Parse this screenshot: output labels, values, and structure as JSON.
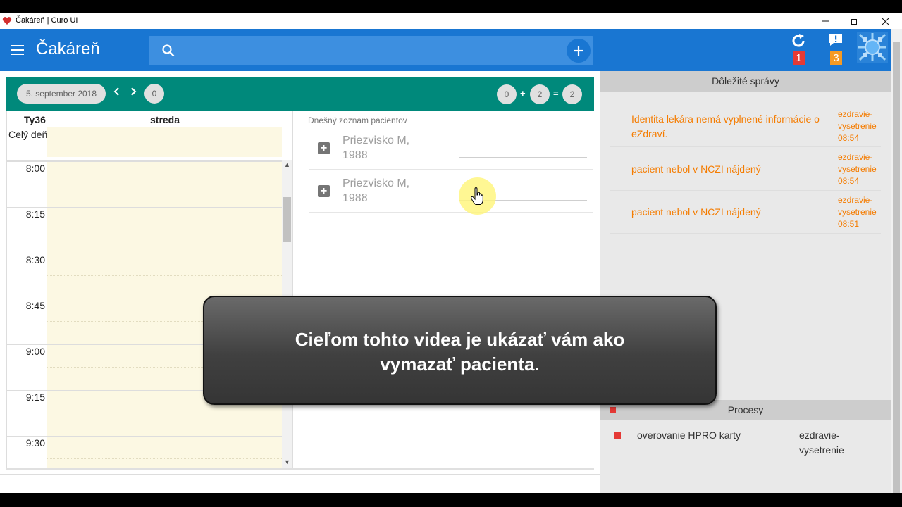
{
  "window": {
    "title": "Čakáreň | Curo UI"
  },
  "appbar": {
    "title": "Čakáreň",
    "search_placeholder": "",
    "sync_badge": "1",
    "alerts_badge": "3",
    "colors": {
      "primary": "#1976d2",
      "badge_red": "#e53935",
      "badge_orange": "#f59a23"
    }
  },
  "toolbar": {
    "date": "5. september 2018",
    "count_left": "0",
    "sum_a": "0",
    "plus": "+",
    "sum_b": "2",
    "equals": "=",
    "sum_total": "2",
    "color": "#00897b"
  },
  "calendar": {
    "week_label": "Ty36",
    "day_label": "streda",
    "all_day_label": "Celý deň",
    "times": [
      "8:00",
      "8:15",
      "8:30",
      "8:45",
      "9:00",
      "9:15",
      "9:30"
    ]
  },
  "patients": {
    "title": "Dnešný zoznam pacientov",
    "items": [
      {
        "name": "Priezvisko M,",
        "year": "1988"
      },
      {
        "name": "Priezvisko M,",
        "year": "1988"
      }
    ]
  },
  "messages": {
    "title": "Dôležité správy",
    "items": [
      {
        "text": "Identita lekára nemá vyplnené informácie o eZdraví.",
        "source": "ezdravie-vysetrenie",
        "time": "08:54"
      },
      {
        "text": "pacient nebol v NCZI nájdený",
        "source": "ezdravie-vysetrenie",
        "time": "08:54"
      },
      {
        "text": "pacient nebol v NCZI nájdený",
        "source": "ezdravie-vysetrenie",
        "time": "08:51"
      }
    ],
    "color": "#f57c00"
  },
  "processes": {
    "title": "Procesy",
    "items": [
      {
        "name": "overovanie HPRO karty",
        "source": "ezdravie-vysetrenie"
      }
    ]
  },
  "overlay": {
    "line1": "Cieľom tohto videa je ukázať vám ako",
    "line2": "vymazať pacienta."
  }
}
